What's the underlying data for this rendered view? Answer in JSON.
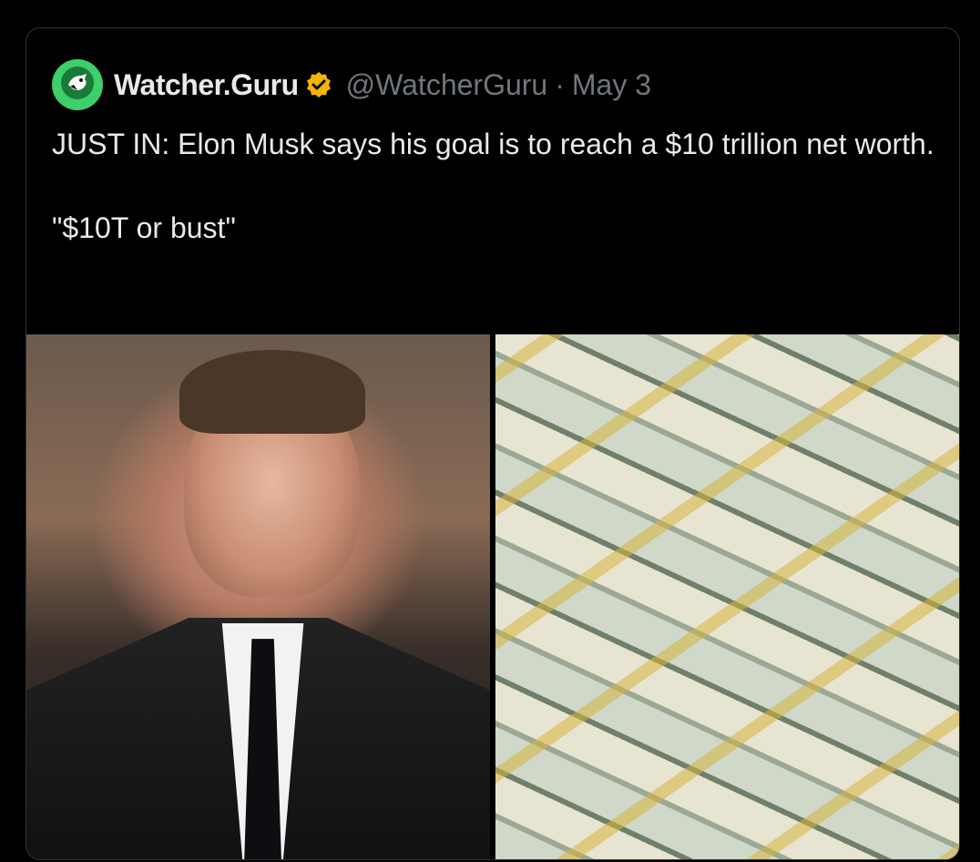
{
  "tweet": {
    "display_name": "Watcher.Guru",
    "handle": "@WatcherGuru",
    "separator": "·",
    "date": "May 3",
    "text": "JUST IN: Elon Musk says his goal is to reach a $10 trillion net worth.\n\n\"$10T or bust\"",
    "verified_badge_color": "#f4b400",
    "avatar_color": "#3ecf6a",
    "avatar_icon": "dog-logo-icon"
  },
  "media": [
    {
      "kind": "photo",
      "subject": "person-portrait"
    },
    {
      "kind": "photo",
      "subject": "cash-stacks"
    }
  ]
}
